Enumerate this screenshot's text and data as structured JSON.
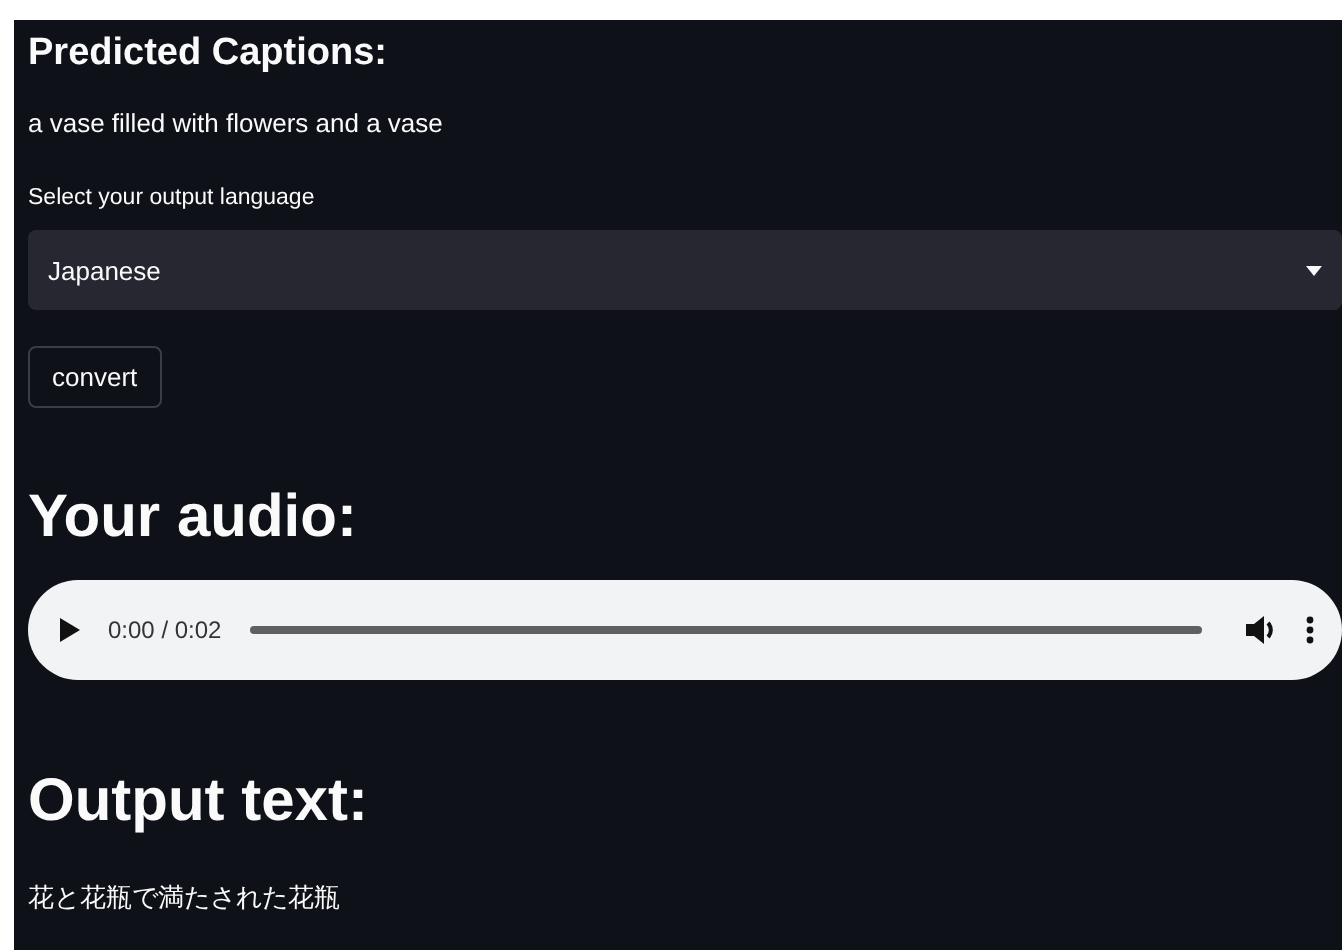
{
  "captions": {
    "heading": "Predicted Captions:",
    "text": "a vase filled with flowers and a vase"
  },
  "language_select": {
    "label": "Select your output language",
    "value": "Japanese"
  },
  "convert_button": "convert",
  "audio": {
    "heading": "Your audio:",
    "time": "0:00 / 0:02"
  },
  "output": {
    "heading": "Output text:",
    "text": "花と花瓶で満たされた花瓶"
  }
}
